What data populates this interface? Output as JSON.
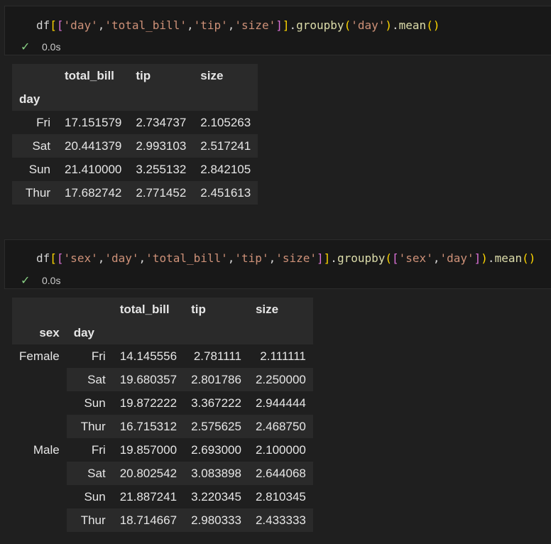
{
  "cell1": {
    "code": {
      "t1": "df",
      "t2": "[",
      "t3": "[",
      "t4": "'day'",
      "t5": ",",
      "t6": "'total_bill'",
      "t7": ",",
      "t8": "'tip'",
      "t9": ",",
      "t10": "'size'",
      "t11": "]",
      "t12": "]",
      "t13": ".",
      "t14": "groupby",
      "t15": "(",
      "t16": "'day'",
      "t17": ")",
      "t18": ".",
      "t19": "mean",
      "t20": "()"
    },
    "status_time": "0.0s",
    "table": {
      "columns": [
        "total_bill",
        "tip",
        "size"
      ],
      "index_name": "day",
      "rows": [
        {
          "idx": "Fri",
          "v": [
            "17.151579",
            "2.734737",
            "2.105263"
          ]
        },
        {
          "idx": "Sat",
          "v": [
            "20.441379",
            "2.993103",
            "2.517241"
          ]
        },
        {
          "idx": "Sun",
          "v": [
            "21.410000",
            "3.255132",
            "2.842105"
          ]
        },
        {
          "idx": "Thur",
          "v": [
            "17.682742",
            "2.771452",
            "2.451613"
          ]
        }
      ]
    }
  },
  "cell2": {
    "code": {
      "t1": "df",
      "t2": "[",
      "t3": "[",
      "t4": "'sex'",
      "t5": ",",
      "t6": "'day'",
      "t7": ",",
      "t8": "'total_bill'",
      "t9": ",",
      "t10": "'tip'",
      "t11": ",",
      "t12": "'size'",
      "t13": "]",
      "t14": "]",
      "t15": ".",
      "t16": "groupby",
      "t17": "(",
      "t18": "[",
      "t19": "'sex'",
      "t20": ",",
      "t21": "'day'",
      "t22": "]",
      "t23": ")",
      "t24": ".",
      "t25": "mean",
      "t26": "()"
    },
    "status_time": "0.0s",
    "table": {
      "columns": [
        "total_bill",
        "tip",
        "size"
      ],
      "index_names": [
        "sex",
        "day"
      ],
      "rows": [
        {
          "sex": "Female",
          "day": "Fri",
          "v": [
            "14.145556",
            "2.781111",
            "2.111111"
          ]
        },
        {
          "sex": "",
          "day": "Sat",
          "v": [
            "19.680357",
            "2.801786",
            "2.250000"
          ]
        },
        {
          "sex": "",
          "day": "Sun",
          "v": [
            "19.872222",
            "3.367222",
            "2.944444"
          ]
        },
        {
          "sex": "",
          "day": "Thur",
          "v": [
            "16.715312",
            "2.575625",
            "2.468750"
          ]
        },
        {
          "sex": "Male",
          "day": "Fri",
          "v": [
            "19.857000",
            "2.693000",
            "2.100000"
          ]
        },
        {
          "sex": "",
          "day": "Sat",
          "v": [
            "20.802542",
            "3.083898",
            "2.644068"
          ]
        },
        {
          "sex": "",
          "day": "Sun",
          "v": [
            "21.887241",
            "3.220345",
            "2.810345"
          ]
        },
        {
          "sex": "",
          "day": "Thur",
          "v": [
            "18.714667",
            "2.980333",
            "2.433333"
          ]
        }
      ]
    }
  },
  "colors": {
    "background": "#1f1f1f",
    "cell_background": "#181818",
    "row_stripe": "#2a2a2a",
    "check_green": "#89d185",
    "string": "#ce9178",
    "function": "#dcdcaa",
    "bracket1": "#ffd700",
    "bracket2": "#da70d6",
    "bracket3": "#179fff"
  },
  "icons": {
    "status": "checkmark-icon"
  }
}
